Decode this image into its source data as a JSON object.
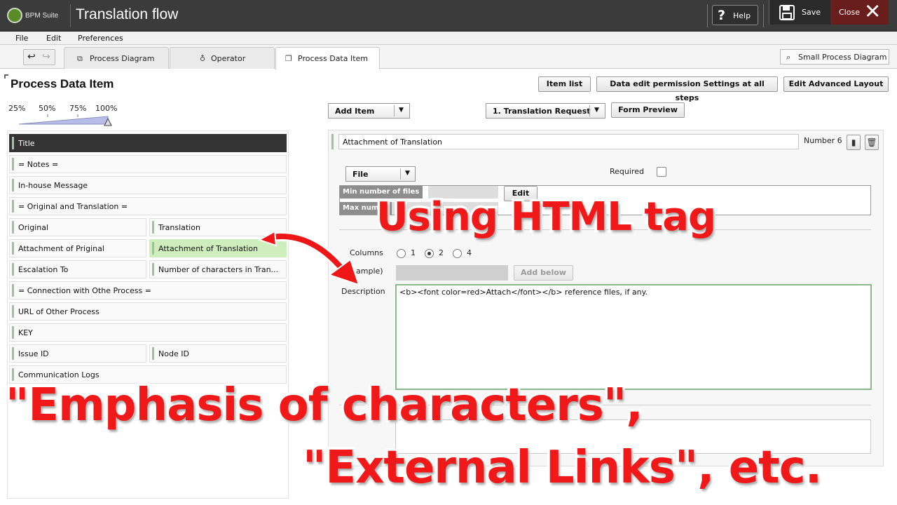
{
  "app": {
    "logo_text": "BPM Suite",
    "title": "Translation flow",
    "help_label": "Help",
    "save_label": "Save",
    "close_label": "Close"
  },
  "menu": [
    "File",
    "Edit",
    "Preferences"
  ],
  "tabs": [
    {
      "label": "Process Diagram",
      "icon": "diagram-icon",
      "active": false
    },
    {
      "label": "Operator",
      "icon": "user-icon",
      "active": false
    },
    {
      "label": "Process Data Item",
      "icon": "copy-icon",
      "active": true
    }
  ],
  "small_diagram_label": "Small Process Diagram",
  "page_title": "Process Data Item",
  "toolbar": {
    "item_list": "Item list",
    "permission": "Data edit permission Settings at all steps",
    "advanced_layout": "Edit Advanced Layout",
    "add_item": "Add Item",
    "step_select": "1. Translation Request",
    "form_preview": "Form Preview"
  },
  "zoom_levels": [
    "25%",
    "50%",
    "75%",
    "100%"
  ],
  "zoom_value": "100%",
  "items": [
    {
      "label": "Title"
    },
    {
      "label": "= Notes ="
    },
    {
      "label": "In-house Message"
    },
    {
      "label": "= Original and Translation ="
    },
    {
      "label": "Original"
    },
    {
      "label": "Translation"
    },
    {
      "label": "Attachment of Priginal"
    },
    {
      "label": "Attachment of Translation"
    },
    {
      "label": "Escalation  To"
    },
    {
      "label": "Number of characters in Tran..."
    },
    {
      "label": "= Connection with Othe Process ="
    },
    {
      "label": "URL of Other Process"
    },
    {
      "label": "KEY"
    },
    {
      "label": "Issue ID"
    },
    {
      "label": "Node ID"
    },
    {
      "label": "Communication Logs"
    }
  ],
  "detail": {
    "name_value": "Attachment of Translation",
    "number_label": "Number 6",
    "type_value": "File",
    "required_label": "Required",
    "required_checked": false,
    "min_files_label": "Min number of files",
    "max_files_label": "Max numb",
    "edit_label": "Edit",
    "columns_label": "Columns",
    "column_options": [
      "1",
      "2",
      "4"
    ],
    "column_selected": "2",
    "example_label": "ample)",
    "add_below_label": "Add below",
    "description_label": "Description",
    "description_value": "<b><font color=red>Attach</font></b> reference files, if any."
  },
  "overlays": {
    "html_tag": "Using HTML tag",
    "emphasis": "\"Emphasis of characters\",",
    "links": "\"External Links\", etc."
  },
  "colors": {
    "overlay_red": "#f01818",
    "accent_green": "#9cc39a",
    "topbar": "#3b3b3b",
    "close_bg": "#6a1d1d"
  }
}
